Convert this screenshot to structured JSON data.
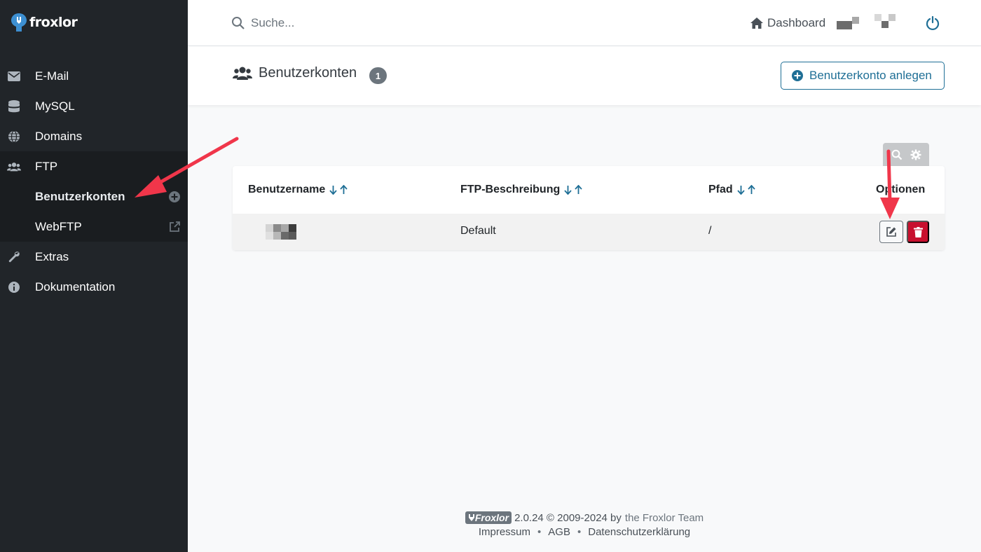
{
  "brand": {
    "name": "froxlor"
  },
  "search": {
    "placeholder": "Suche..."
  },
  "header": {
    "dashboard_label": "Dashboard"
  },
  "sidebar": {
    "items": [
      {
        "label": "E-Mail",
        "icon": "envelope-icon"
      },
      {
        "label": "MySQL",
        "icon": "database-icon"
      },
      {
        "label": "Domains",
        "icon": "globe-icon"
      },
      {
        "label": "FTP",
        "icon": "users-icon"
      },
      {
        "label": "Extras",
        "icon": "wrench-icon"
      },
      {
        "label": "Dokumentation",
        "icon": "info-icon"
      }
    ],
    "ftp_sub": [
      {
        "label": "Benutzerkonten",
        "icon": "plus-circle-icon"
      },
      {
        "label": "WebFTP",
        "icon": "external-link-icon"
      }
    ]
  },
  "page": {
    "title": "Benutzerkonten",
    "count": "1",
    "add_button": "Benutzerkonto anlegen"
  },
  "table": {
    "columns": [
      "Benutzername",
      "FTP-Beschreibung",
      "Pfad",
      "Optionen"
    ],
    "rows": [
      {
        "username": "",
        "description": "Default",
        "path": "/"
      }
    ]
  },
  "footer": {
    "logo": "Froxlor",
    "version": "2.0.24 © 2009-2024 by",
    "team": "the Froxlor Team",
    "links": [
      "Impressum",
      "AGB",
      "Datenschutzerklärung"
    ]
  },
  "colors": {
    "sidebar_bg": "#212529",
    "accent": "#1f6f96",
    "danger": "#c8102e",
    "annotation": "#f0364a"
  }
}
